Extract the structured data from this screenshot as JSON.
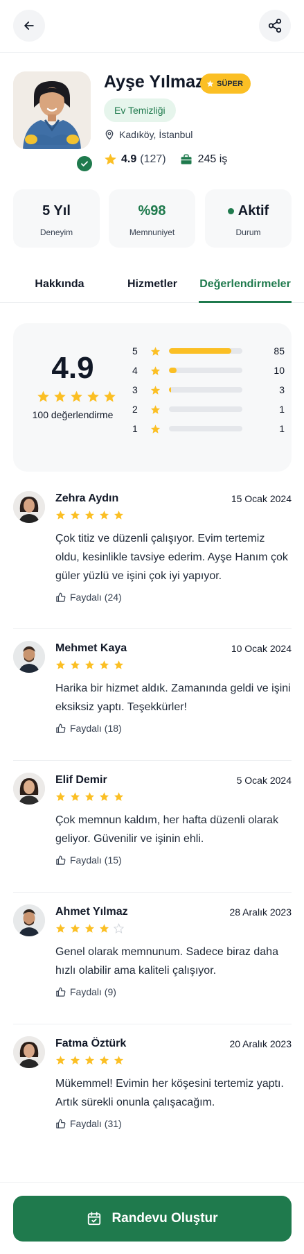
{
  "header": {
    "back_icon": "arrow-left-icon",
    "share_icon": "share-icon"
  },
  "profile": {
    "name": "Ayşe Yılmaz",
    "super_badge": "SÜPER",
    "category": "Ev Temizliği",
    "location": "Kadıköy, İstanbul",
    "rating": "4.9",
    "review_count": "(127)",
    "jobs": "245 iş"
  },
  "info_cards": [
    {
      "value": "5 Yıl",
      "label": "Deneyim"
    },
    {
      "value": "%98",
      "label": "Memnuniyet"
    },
    {
      "value": "Aktif",
      "label": "Durum"
    }
  ],
  "tabs": [
    {
      "label": "Hakkında",
      "active": false
    },
    {
      "label": "Hizmetler",
      "active": false
    },
    {
      "label": "Değerlendirmeler",
      "active": true
    }
  ],
  "rating_summary": {
    "average": "4.9",
    "total_label": "100 değerlendirme",
    "distribution": [
      {
        "stars": "5",
        "count": "85",
        "fraction": 0.85
      },
      {
        "stars": "4",
        "count": "10",
        "fraction": 0.1
      },
      {
        "stars": "3",
        "count": "3",
        "fraction": 0.03
      },
      {
        "stars": "2",
        "count": "1",
        "fraction": 0.0
      },
      {
        "stars": "1",
        "count": "1",
        "fraction": 0.0
      }
    ]
  },
  "reviews": [
    {
      "name": "Zehra Aydın",
      "date": "15 Ocak 2024",
      "rating": 5,
      "text": "Çok titiz ve düzenli çalışıyor. Evim tertemiz oldu, kesinlikle tavsiye ederim. Ayşe Hanım çok güler yüzlü ve işini çok iyi yapıyor.",
      "helpful": "Faydalı (24)"
    },
    {
      "name": "Mehmet Kaya",
      "date": "10 Ocak 2024",
      "rating": 5,
      "text": "Harika bir hizmet aldık. Zamanında geldi ve işini eksiksiz yaptı. Teşekkürler!",
      "helpful": "Faydalı (18)"
    },
    {
      "name": "Elif Demir",
      "date": "5 Ocak 2024",
      "rating": 5,
      "text": "Çok memnun kaldım, her hafta düzenli olarak geliyor. Güvenilir ve işinin ehli.",
      "helpful": "Faydalı (15)"
    },
    {
      "name": "Ahmet Yılmaz",
      "date": "28 Aralık 2023",
      "rating": 4,
      "text": "Genel olarak memnunum. Sadece biraz daha hızlı olabilir ama kaliteli çalışıyor.",
      "helpful": "Faydalı (9)"
    },
    {
      "name": "Fatma Öztürk",
      "date": "20 Aralık 2023",
      "rating": 5,
      "text": "Mükemmel! Evimin her köşesini tertemiz yaptı. Artık sürekli onunla çalışacağım.",
      "helpful": "Faydalı (31)"
    }
  ],
  "cta": {
    "label": "Randevu Oluştur",
    "icon": "calendar-check-icon"
  },
  "colors": {
    "primary": "#1f7a4d",
    "star": "#fbbf24",
    "chip_bg": "#e6f5ec"
  }
}
